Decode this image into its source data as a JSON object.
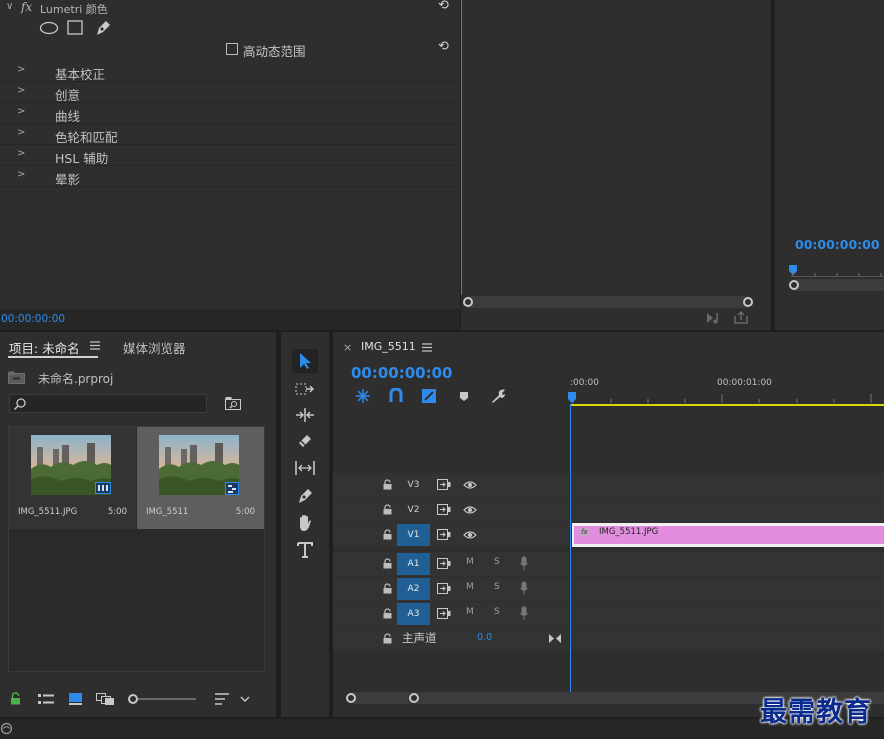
{
  "effect_controls": {
    "effect_name": "Lumetri 颜色",
    "fx_symbol": "fx",
    "hdr_checkbox_label": "高动态范围",
    "sections": [
      {
        "label": "基本校正"
      },
      {
        "label": "创意"
      },
      {
        "label": "曲线"
      },
      {
        "label": "色轮和匹配"
      },
      {
        "label": "HSL 辅助"
      },
      {
        "label": "晕影"
      }
    ],
    "timecode": "00:00:00:00",
    "icons": [
      "ellipse-mask-icon",
      "rectangle-mask-icon",
      "pen-mask-icon",
      "reset-icon",
      "chevron-right-icon"
    ]
  },
  "program_monitor": {
    "timecode": "00:00:00:00"
  },
  "project": {
    "tab_project": "项目: 未命名",
    "tab_media_browser": "媒体浏览器",
    "file_name": "未命名.prproj",
    "items": [
      {
        "name": "IMG_5511.JPG",
        "duration": "5:00",
        "selected": false,
        "badge": "image-icon"
      },
      {
        "name": "IMG_5511",
        "duration": "5:00",
        "selected": true,
        "badge": "sequence-icon"
      }
    ]
  },
  "timeline": {
    "sequence_name": "IMG_5511",
    "timecode": "00:00:00:00",
    "ruler_labels": [
      ":00:00",
      "00:00:01:00"
    ],
    "tracks": [
      {
        "name": "V3",
        "type": "video",
        "targeted": false
      },
      {
        "name": "V2",
        "type": "video",
        "targeted": false
      },
      {
        "name": "V1",
        "type": "video",
        "targeted": true
      },
      {
        "name": "A1",
        "type": "audio",
        "targeted": true
      },
      {
        "name": "A2",
        "type": "audio",
        "targeted": true
      },
      {
        "name": "A3",
        "type": "audio",
        "targeted": true
      }
    ],
    "mute_label": "M",
    "solo_label": "S",
    "master_label": "主声道",
    "master_value": "0.0",
    "clip": {
      "name": "IMG_5511.JPG",
      "fx": "fx",
      "color": "#e38de0"
    }
  },
  "watermark": "最需教育",
  "colors": {
    "accent_blue": "#2d8ceb",
    "clip_pink": "#e38de0",
    "work_area_yellow": "#d8d800",
    "target_blue": "#1f5f94"
  }
}
